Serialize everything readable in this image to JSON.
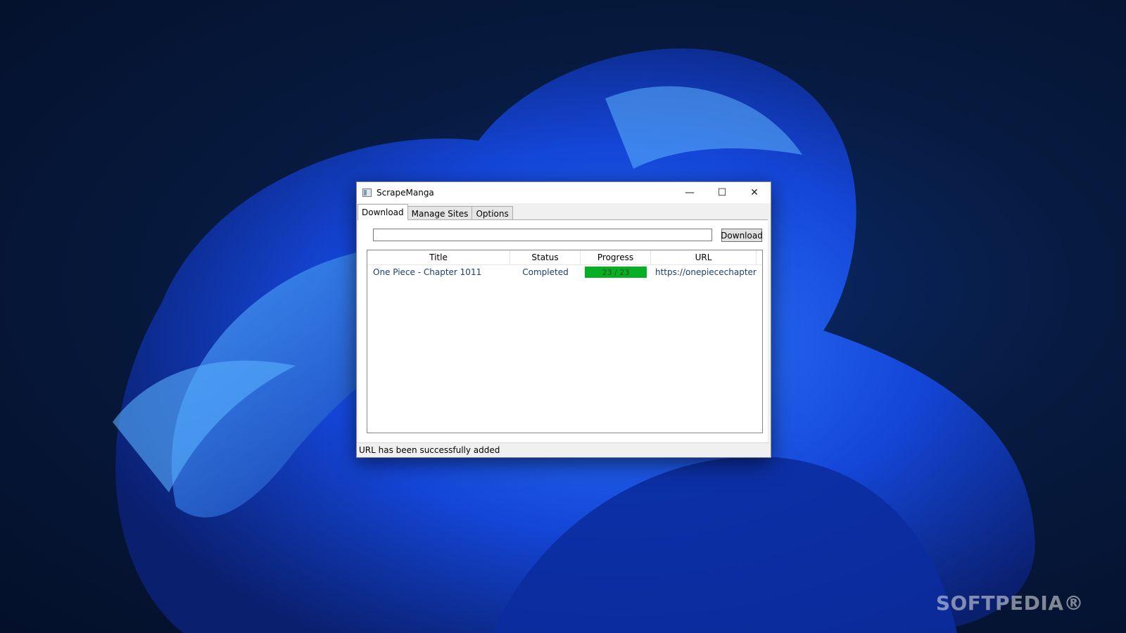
{
  "window": {
    "title": "ScrapeManga",
    "minimize_glyph": "—",
    "maximize_glyph": "☐",
    "close_glyph": "✕"
  },
  "tabs": [
    {
      "label": "Download",
      "active": true
    },
    {
      "label": "Manage Sites",
      "active": false
    },
    {
      "label": "Options",
      "active": false
    }
  ],
  "download": {
    "url_value": "",
    "button_label": "Download"
  },
  "table": {
    "columns": [
      "Title",
      "Status",
      "Progress",
      "URL"
    ],
    "rows": [
      {
        "title": "One Piece - Chapter 1011",
        "status": "Completed",
        "progress_text": "23 / 23",
        "progress_fraction": 1.0,
        "url": "https://onepiecechapter..."
      }
    ]
  },
  "status_bar": {
    "message": "URL has been successfully added"
  },
  "watermark": "SOFTPEDIA®",
  "colors": {
    "progress_fill": "#06b025",
    "desktop_bg": "#04102a",
    "wallpaper_accent": "#1f5cff"
  },
  "icons": {
    "app": "app-window-icon",
    "minimize": "minimize-icon",
    "maximize": "maximize-icon",
    "close": "close-icon"
  }
}
